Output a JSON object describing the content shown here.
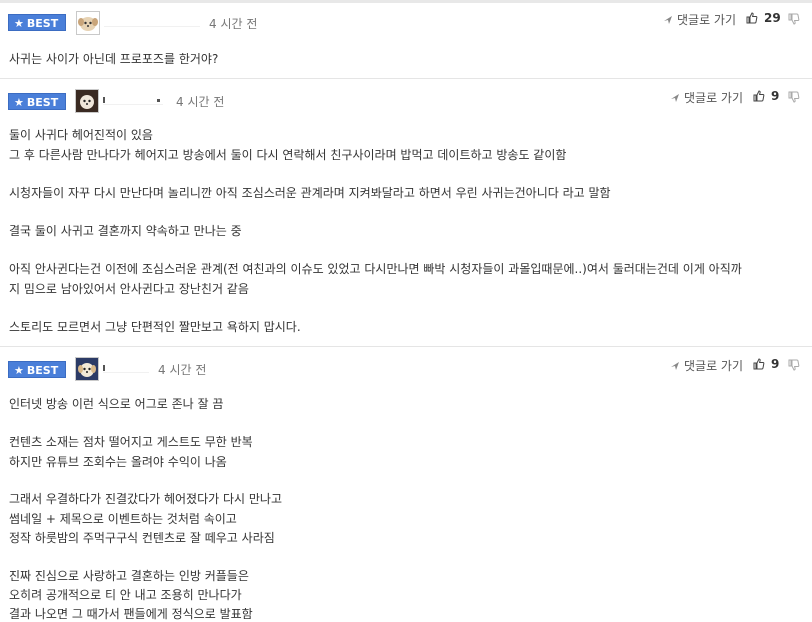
{
  "ui": {
    "best_label": "BEST",
    "reply_label": "댓글로 가기"
  },
  "icons": {
    "best": "star-icon",
    "reply": "reply-arrow-icon",
    "like": "thumbs-up-icon",
    "dislike": "thumbs-down-icon"
  },
  "colors": {
    "best_badge": "#4a7fd9",
    "text": "#333333",
    "meta": "#777777"
  },
  "comments": [
    {
      "time": "4 시간 전",
      "likes": "29",
      "lines": [
        "사귀는 사이가 아닌데 프로포즈를 한거야?"
      ]
    },
    {
      "time": "4 시간 전",
      "likes": "9",
      "lines": [
        "둘이 사귀다 헤어진적이 있음",
        "그 후 다른사람 만나다가 헤어지고 방송에서 둘이 다시 연락해서 친구사이라며 밥먹고 데이트하고 방송도 같이함",
        "시청자들이 자꾸 다시 만난다며 놀리니깐 아직 조심스러운 관계라며 지켜봐달라고 하면서 우린 사귀는건아니다 라고 말함",
        "결국 둘이 사귀고 결혼까지 약속하고 만나는 중",
        "아직 안사귄다는건 이전에 조심스러운 관계(전 여친과의 이슈도 있었고 다시만나면 빠박 시청자들이 과몰입때문에..)여서 둘러대는건데 이게 아직까",
        "지 밈으로 남아있어서 안사귄다고 장난친거 같음",
        "스토리도 모르면서 그냥 단편적인 짤만보고 욕하지 맙시다."
      ]
    },
    {
      "time": "4 시간 전",
      "likes": "9",
      "lines": [
        "인터넷 방송 이런 식으로 어그로 존나 잘 끔",
        "컨텐츠 소재는 점차 떨어지고 게스트도 무한 반복",
        "하지만 유튜브 조회수는 올려야 수익이 나옴",
        "그래서 우결하다가 진결갔다가 헤어졌다가 다시 만나고",
        "썸네일 + 제목으로 이벤트하는 것처럼 속이고",
        "정작 하룻밤의 주먹구구식 컨텐츠로 잘 떼우고 사라짐",
        "진짜 진심으로 사랑하고 결혼하는 인방 커플들은",
        "오히려 공개적으로 티 안 내고 조용히 만나다가",
        "결과 나오면 그 때가서 팬들에게 정식으로 발표함"
      ]
    }
  ]
}
